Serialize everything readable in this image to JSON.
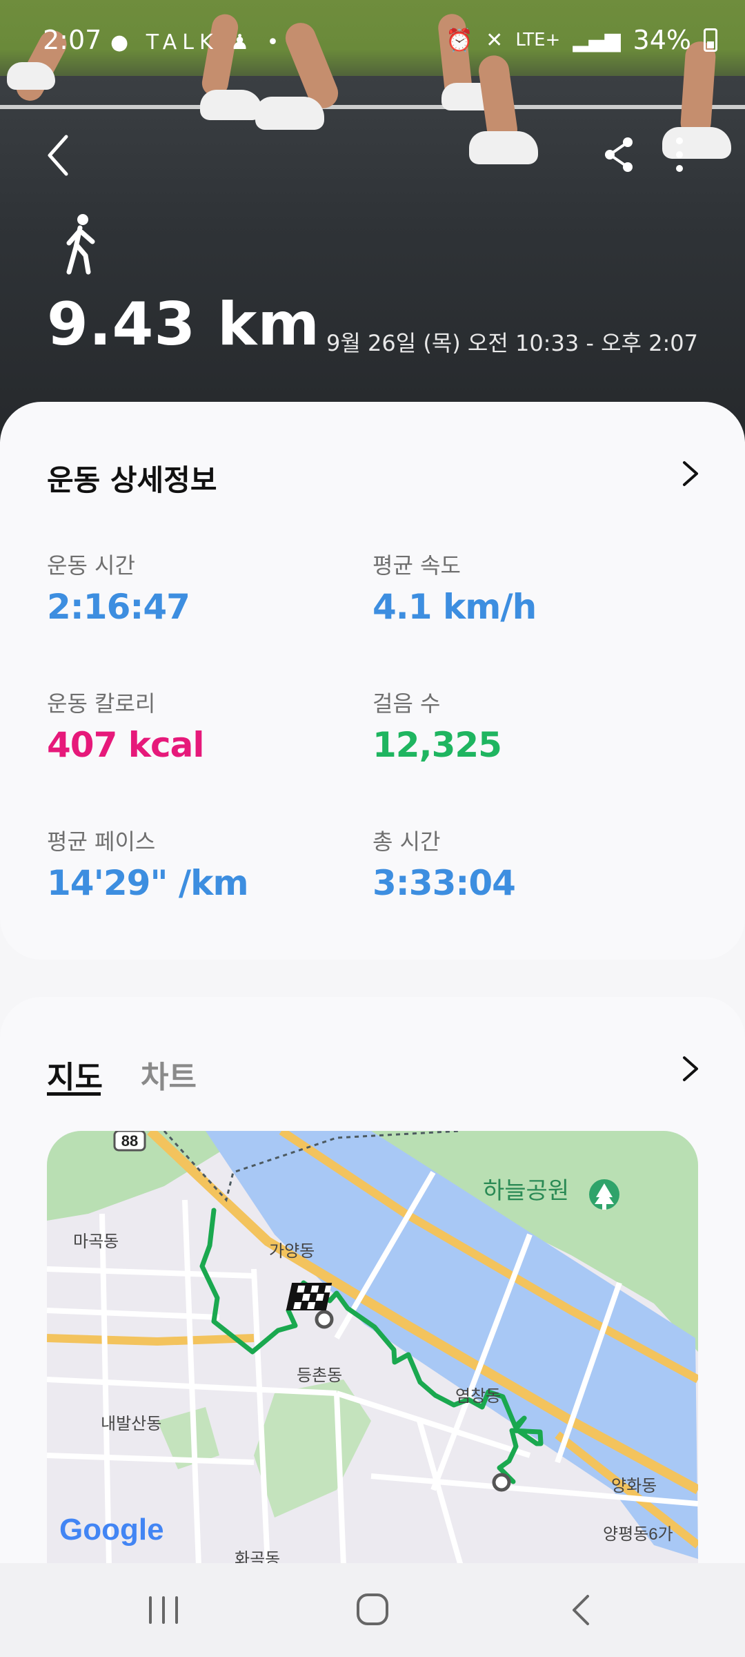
{
  "status_bar": {
    "time": "2:07",
    "icons_left": "● TALK ♟ •",
    "network": "LTE+",
    "battery_percent": "34%"
  },
  "hero": {
    "distance": "9.43 km",
    "date_range": "9월 26일 (목) 오전 10:33 - 오후 2:07",
    "activity_icon": "walk-icon"
  },
  "details": {
    "title": "운동 상세정보",
    "metrics": [
      {
        "label": "운동 시간",
        "value": "2:16:47",
        "color": "#3d8ee0"
      },
      {
        "label": "평균 속도",
        "value": "4.1 km/h",
        "color": "#3d8ee0"
      },
      {
        "label": "운동 칼로리",
        "value": "407 kcal",
        "color": "#e6197a"
      },
      {
        "label": "걸음 수",
        "value": "12,325",
        "color": "#1fb560"
      },
      {
        "label": "평균 페이스",
        "value": "14'29\" /km",
        "color": "#3d8ee0"
      },
      {
        "label": "총 시간",
        "value": "3:33:04",
        "color": "#3d8ee0"
      }
    ]
  },
  "map_section": {
    "tabs": [
      "지도",
      "차트"
    ],
    "active_tab": "지도",
    "labels": {
      "road_badge": "88",
      "magok": "마곡동",
      "gayang": "가양동",
      "haneul_park": "하늘공원",
      "deungchon": "등촌동",
      "yeomchang": "염창동",
      "naebalsan": "내발산동",
      "yanghwa": "양화동",
      "yangpyeong": "양평동6가",
      "hwagok": "화곡동",
      "google": "Google"
    }
  },
  "colors": {
    "accent_blue": "#3d8ee0",
    "calorie_pink": "#e6197a",
    "steps_green": "#1fb560",
    "route_green": "#1aa84f"
  }
}
